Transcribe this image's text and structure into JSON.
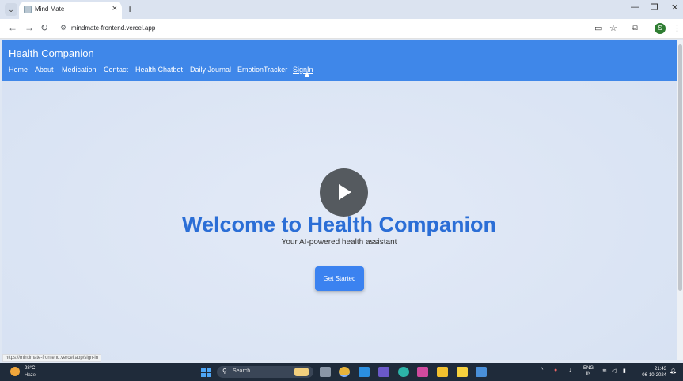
{
  "browser": {
    "tab_title": "Mind Mate",
    "tab_close": "×",
    "new_tab": "+",
    "url": "mindmate-frontend.vercel.app",
    "status_url": "https://mindmate-frontend.vercel.app/sign-in",
    "profile_initial": "S",
    "icons": [
      "tab-list",
      "back",
      "forward",
      "reload",
      "site-info",
      "install",
      "bookmark-star",
      "extensions",
      "menu",
      "minimize",
      "restore",
      "close"
    ]
  },
  "app": {
    "brand": "Health Companion",
    "nav": [
      "Home",
      "About",
      "Medication",
      "Contact",
      "Health Chatbot",
      "Daily Journal",
      "EmotionTracker",
      "SignIn"
    ],
    "hero_title": "Welcome to Health Companion",
    "hero_subtitle": "Your AI-powered health assistant",
    "cta_label": "Get Started",
    "colors": {
      "header": "#3f87e9",
      "title": "#2b6ed6",
      "cta": "#3b82f0"
    }
  },
  "taskbar": {
    "temperature": "28°C",
    "condition": "Haze",
    "search_label": "Search",
    "lang_line1": "ENG",
    "lang_line2": "IN",
    "time": "21:43",
    "date": "06-10-2024"
  }
}
